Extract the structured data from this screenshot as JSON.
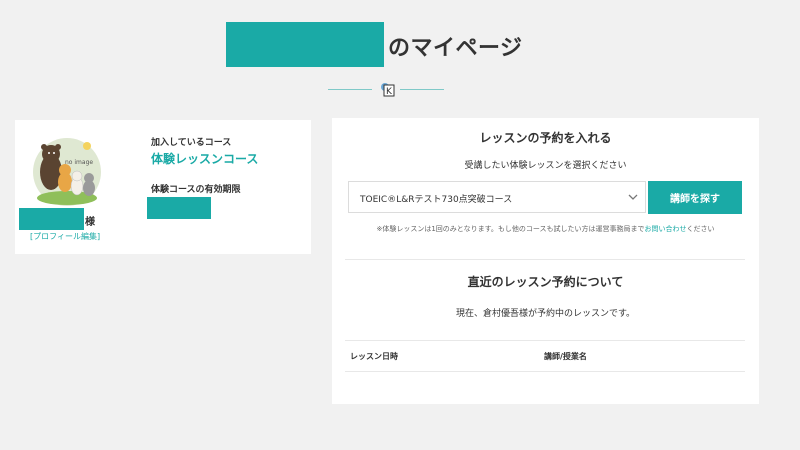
{
  "header": {
    "title_suffix": "のマイページ"
  },
  "profile": {
    "avatar_label": "no image",
    "course_label": "加入しているコース",
    "course_value": "体験レッスンコース",
    "expiry_label": "体験コースの有効期限",
    "name_suffix": "様",
    "edit_link": "[プロフィール編集]"
  },
  "reservation": {
    "title": "レッスンの予約を入れる",
    "subtitle": "受講したい体験レッスンを選択ください",
    "selected_course": "TOEIC®L&Rテスト730点突破コース",
    "find_button": "講師を探す",
    "note_text": "※体験レッスンは1回のみとなります。もし他のコースも試したい方は運営事務局まで",
    "note_link": "お問い合わせ",
    "note_end": "ください"
  },
  "recent": {
    "title": "直近のレッスン予約について",
    "subtitle": "現在、倉村優吾様が予約中のレッスンです。",
    "columns": [
      "レッスン日時",
      "講師/授業名"
    ]
  },
  "colors": {
    "accent": "#1aaaa6",
    "background": "#f1f1f1"
  }
}
